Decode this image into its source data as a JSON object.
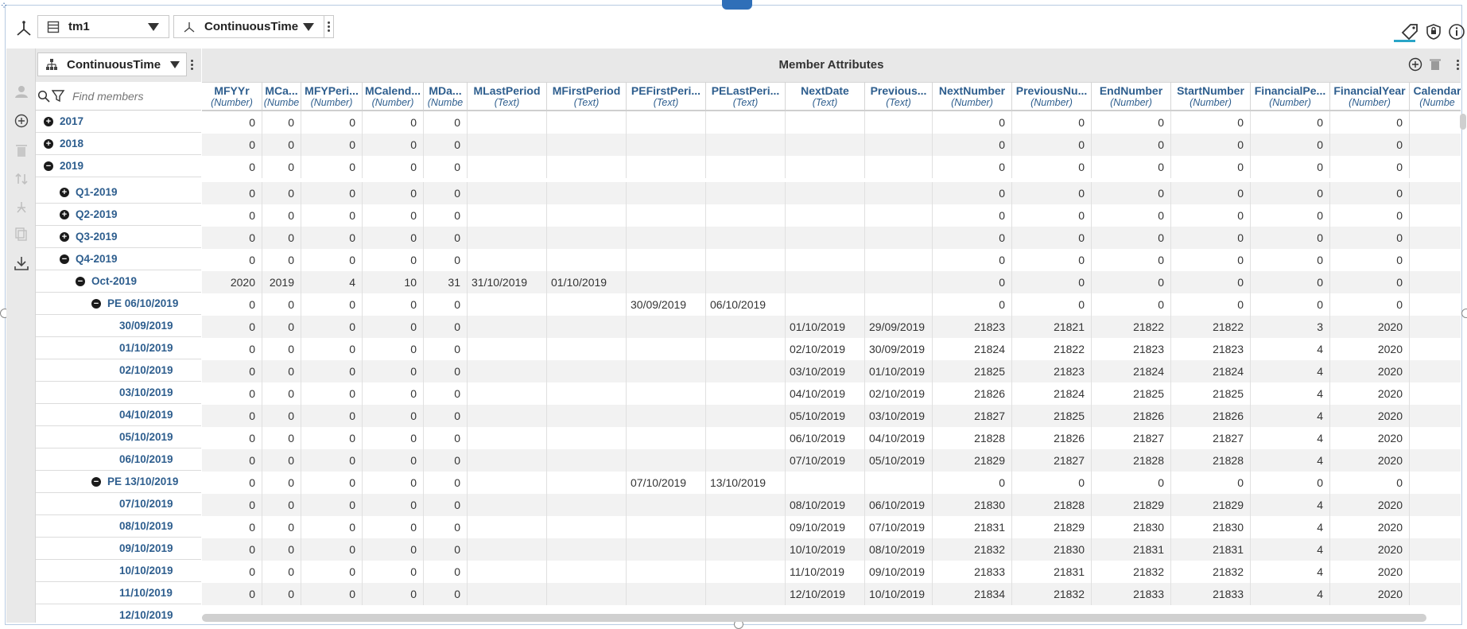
{
  "toolbar": {
    "cube_select": "tm1",
    "dimension_select": "ContinuousTime"
  },
  "tree": {
    "hierarchy_select": "ContinuousTime",
    "search_placeholder": "Find members",
    "items": [
      {
        "label": "2017",
        "level": 0,
        "state": "collapsed"
      },
      {
        "label": "2018",
        "level": 0,
        "state": "collapsed"
      },
      {
        "label": "2019",
        "level": 0,
        "state": "expanded"
      },
      {
        "label": "Q1-2019",
        "level": 1,
        "state": "collapsed"
      },
      {
        "label": "Q2-2019",
        "level": 1,
        "state": "collapsed"
      },
      {
        "label": "Q3-2019",
        "level": 1,
        "state": "collapsed"
      },
      {
        "label": "Q4-2019",
        "level": 1,
        "state": "expanded"
      },
      {
        "label": "Oct-2019",
        "level": 2,
        "state": "expanded"
      },
      {
        "label": "PE 06/10/2019",
        "level": 3,
        "state": "expanded"
      },
      {
        "label": "30/09/2019",
        "level": 4,
        "state": "leaf"
      },
      {
        "label": "01/10/2019",
        "level": 4,
        "state": "leaf"
      },
      {
        "label": "02/10/2019",
        "level": 4,
        "state": "leaf"
      },
      {
        "label": "03/10/2019",
        "level": 4,
        "state": "leaf"
      },
      {
        "label": "04/10/2019",
        "level": 4,
        "state": "leaf"
      },
      {
        "label": "05/10/2019",
        "level": 4,
        "state": "leaf"
      },
      {
        "label": "06/10/2019",
        "level": 4,
        "state": "leaf"
      },
      {
        "label": "PE 13/10/2019",
        "level": 3,
        "state": "expanded"
      },
      {
        "label": "07/10/2019",
        "level": 4,
        "state": "leaf"
      },
      {
        "label": "08/10/2019",
        "level": 4,
        "state": "leaf"
      },
      {
        "label": "09/10/2019",
        "level": 4,
        "state": "leaf"
      },
      {
        "label": "10/10/2019",
        "level": 4,
        "state": "leaf"
      },
      {
        "label": "11/10/2019",
        "level": 4,
        "state": "leaf"
      },
      {
        "label": "12/10/2019",
        "level": 4,
        "state": "leaf"
      }
    ]
  },
  "grid": {
    "title": "Member Attributes",
    "columns": [
      {
        "name": "MFYYr",
        "type": "(Number)",
        "kind": "num"
      },
      {
        "name": "MCa...",
        "type": "(Numbe",
        "kind": "num"
      },
      {
        "name": "MFYPeri...",
        "type": "(Number)",
        "kind": "num"
      },
      {
        "name": "MCalend...",
        "type": "(Number)",
        "kind": "num"
      },
      {
        "name": "MDa...",
        "type": "(Numbe",
        "kind": "num"
      },
      {
        "name": "MLastPeriod",
        "type": "(Text)",
        "kind": "txt"
      },
      {
        "name": "MFirstPeriod",
        "type": "(Text)",
        "kind": "txt"
      },
      {
        "name": "PEFirstPeri...",
        "type": "(Text)",
        "kind": "txt"
      },
      {
        "name": "PELastPeri...",
        "type": "(Text)",
        "kind": "txt"
      },
      {
        "name": "NextDate",
        "type": "(Text)",
        "kind": "txt"
      },
      {
        "name": "Previous...",
        "type": "(Text)",
        "kind": "txt"
      },
      {
        "name": "NextNumber",
        "type": "(Number)",
        "kind": "num"
      },
      {
        "name": "PreviousNu...",
        "type": "(Number)",
        "kind": "num"
      },
      {
        "name": "EndNumber",
        "type": "(Number)",
        "kind": "num"
      },
      {
        "name": "StartNumber",
        "type": "(Number)",
        "kind": "num"
      },
      {
        "name": "FinancialPe...",
        "type": "(Number)",
        "kind": "num"
      },
      {
        "name": "FinancialYear",
        "type": "(Number)",
        "kind": "num"
      },
      {
        "name": "Calendar",
        "type": "(Numbe",
        "kind": "num"
      }
    ],
    "rows": [
      [
        "0",
        "0",
        "0",
        "0",
        "0",
        "",
        "",
        "",
        "",
        "",
        "",
        "0",
        "0",
        "0",
        "0",
        "0",
        "0",
        ""
      ],
      [
        "0",
        "0",
        "0",
        "0",
        "0",
        "",
        "",
        "",
        "",
        "",
        "",
        "0",
        "0",
        "0",
        "0",
        "0",
        "0",
        ""
      ],
      [
        "0",
        "0",
        "0",
        "0",
        "0",
        "",
        "",
        "",
        "",
        "",
        "",
        "0",
        "0",
        "0",
        "0",
        "0",
        "0",
        ""
      ],
      [
        "0",
        "0",
        "0",
        "0",
        "0",
        "",
        "",
        "",
        "",
        "",
        "",
        "0",
        "0",
        "0",
        "0",
        "0",
        "0",
        ""
      ],
      [
        "0",
        "0",
        "0",
        "0",
        "0",
        "",
        "",
        "",
        "",
        "",
        "",
        "0",
        "0",
        "0",
        "0",
        "0",
        "0",
        ""
      ],
      [
        "0",
        "0",
        "0",
        "0",
        "0",
        "",
        "",
        "",
        "",
        "",
        "",
        "0",
        "0",
        "0",
        "0",
        "0",
        "0",
        ""
      ],
      [
        "0",
        "0",
        "0",
        "0",
        "0",
        "",
        "",
        "",
        "",
        "",
        "",
        "0",
        "0",
        "0",
        "0",
        "0",
        "0",
        ""
      ],
      [
        "2020",
        "2019",
        "4",
        "10",
        "31",
        "31/10/2019",
        "01/10/2019",
        "",
        "",
        "",
        "",
        "0",
        "0",
        "0",
        "0",
        "0",
        "0",
        ""
      ],
      [
        "0",
        "0",
        "0",
        "0",
        "0",
        "",
        "",
        "30/09/2019",
        "06/10/2019",
        "",
        "",
        "0",
        "0",
        "0",
        "0",
        "0",
        "0",
        ""
      ],
      [
        "0",
        "0",
        "0",
        "0",
        "0",
        "",
        "",
        "",
        "",
        "01/10/2019",
        "29/09/2019",
        "21823",
        "21821",
        "21822",
        "21822",
        "3",
        "2020",
        ""
      ],
      [
        "0",
        "0",
        "0",
        "0",
        "0",
        "",
        "",
        "",
        "",
        "02/10/2019",
        "30/09/2019",
        "21824",
        "21822",
        "21823",
        "21823",
        "4",
        "2020",
        ""
      ],
      [
        "0",
        "0",
        "0",
        "0",
        "0",
        "",
        "",
        "",
        "",
        "03/10/2019",
        "01/10/2019",
        "21825",
        "21823",
        "21824",
        "21824",
        "4",
        "2020",
        ""
      ],
      [
        "0",
        "0",
        "0",
        "0",
        "0",
        "",
        "",
        "",
        "",
        "04/10/2019",
        "02/10/2019",
        "21826",
        "21824",
        "21825",
        "21825",
        "4",
        "2020",
        ""
      ],
      [
        "0",
        "0",
        "0",
        "0",
        "0",
        "",
        "",
        "",
        "",
        "05/10/2019",
        "03/10/2019",
        "21827",
        "21825",
        "21826",
        "21826",
        "4",
        "2020",
        ""
      ],
      [
        "0",
        "0",
        "0",
        "0",
        "0",
        "",
        "",
        "",
        "",
        "06/10/2019",
        "04/10/2019",
        "21828",
        "21826",
        "21827",
        "21827",
        "4",
        "2020",
        ""
      ],
      [
        "0",
        "0",
        "0",
        "0",
        "0",
        "",
        "",
        "",
        "",
        "07/10/2019",
        "05/10/2019",
        "21829",
        "21827",
        "21828",
        "21828",
        "4",
        "2020",
        ""
      ],
      [
        "0",
        "0",
        "0",
        "0",
        "0",
        "",
        "",
        "07/10/2019",
        "13/10/2019",
        "",
        "",
        "0",
        "0",
        "0",
        "0",
        "0",
        "0",
        ""
      ],
      [
        "0",
        "0",
        "0",
        "0",
        "0",
        "",
        "",
        "",
        "",
        "08/10/2019",
        "06/10/2019",
        "21830",
        "21828",
        "21829",
        "21829",
        "4",
        "2020",
        ""
      ],
      [
        "0",
        "0",
        "0",
        "0",
        "0",
        "",
        "",
        "",
        "",
        "09/10/2019",
        "07/10/2019",
        "21831",
        "21829",
        "21830",
        "21830",
        "4",
        "2020",
        ""
      ],
      [
        "0",
        "0",
        "0",
        "0",
        "0",
        "",
        "",
        "",
        "",
        "10/10/2019",
        "08/10/2019",
        "21832",
        "21830",
        "21831",
        "21831",
        "4",
        "2020",
        ""
      ],
      [
        "0",
        "0",
        "0",
        "0",
        "0",
        "",
        "",
        "",
        "",
        "11/10/2019",
        "09/10/2019",
        "21833",
        "21831",
        "21832",
        "21832",
        "4",
        "2020",
        ""
      ],
      [
        "0",
        "0",
        "0",
        "0",
        "0",
        "",
        "",
        "",
        "",
        "12/10/2019",
        "10/10/2019",
        "21834",
        "21832",
        "21833",
        "21833",
        "4",
        "2020",
        ""
      ]
    ]
  },
  "icons": {
    "axis": "axis-icon",
    "cube": "cube-icon",
    "dimension": "dimension-icon",
    "hierarchy": "hierarchy-icon",
    "tag": "tag-icon",
    "security": "lock-icon",
    "info": "info-icon",
    "add": "add-icon",
    "delete": "trash-icon",
    "menu": "kebab-icon"
  },
  "colors": {
    "link_text": "#2e5e8e",
    "accent_underline": "#2aa5c7",
    "top_handle": "#2f6fb8"
  }
}
